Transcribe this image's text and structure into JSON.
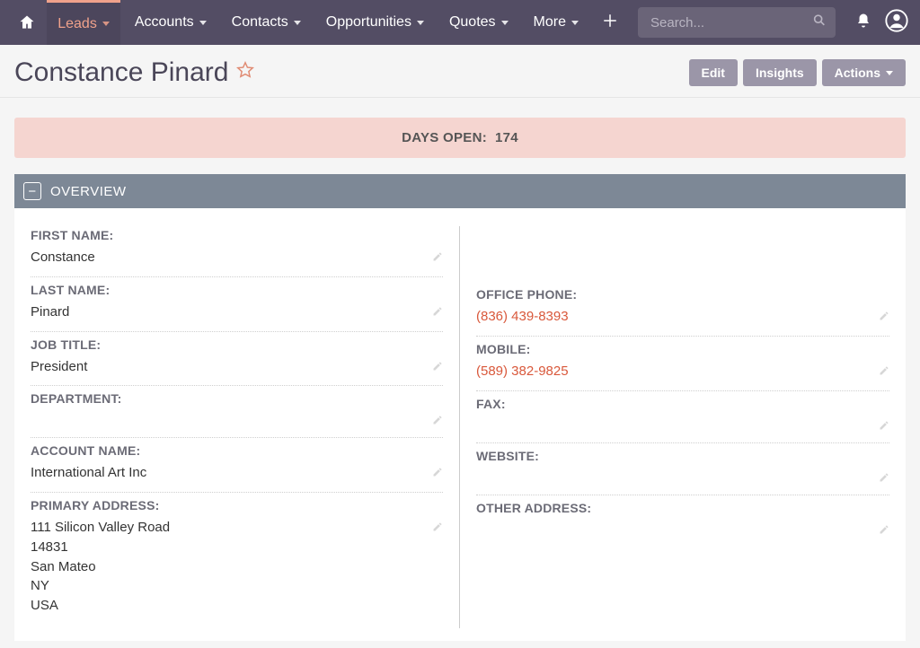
{
  "nav": {
    "leads": "Leads",
    "accounts": "Accounts",
    "contacts": "Contacts",
    "opportunities": "Opportunities",
    "quotes": "Quotes",
    "more": "More",
    "search_placeholder": "Search..."
  },
  "header": {
    "title": "Constance Pinard",
    "edit": "Edit",
    "insights": "Insights",
    "actions": "Actions"
  },
  "banner": {
    "label": "DAYS OPEN:",
    "value": "174"
  },
  "section": {
    "overview": "OVERVIEW"
  },
  "fields": {
    "first_name_label": "FIRST NAME:",
    "first_name": "Constance",
    "last_name_label": "LAST NAME:",
    "last_name": "Pinard",
    "job_title_label": "JOB TITLE:",
    "job_title": "President",
    "department_label": "DEPARTMENT:",
    "department": "",
    "account_name_label": "ACCOUNT NAME:",
    "account_name": "International Art Inc",
    "primary_address_label": "PRIMARY ADDRESS:",
    "address": {
      "line1": "111 Silicon Valley Road",
      "line2": "14831",
      "line3": "San Mateo",
      "line4": "NY",
      "line5": "USA"
    },
    "office_phone_label": "OFFICE PHONE:",
    "office_phone": "(836) 439-8393",
    "mobile_label": "MOBILE:",
    "mobile": "(589) 382-9825",
    "fax_label": "FAX:",
    "fax": "",
    "website_label": "WEBSITE:",
    "website": "",
    "other_address_label": "OTHER ADDRESS:",
    "other_address": ""
  }
}
